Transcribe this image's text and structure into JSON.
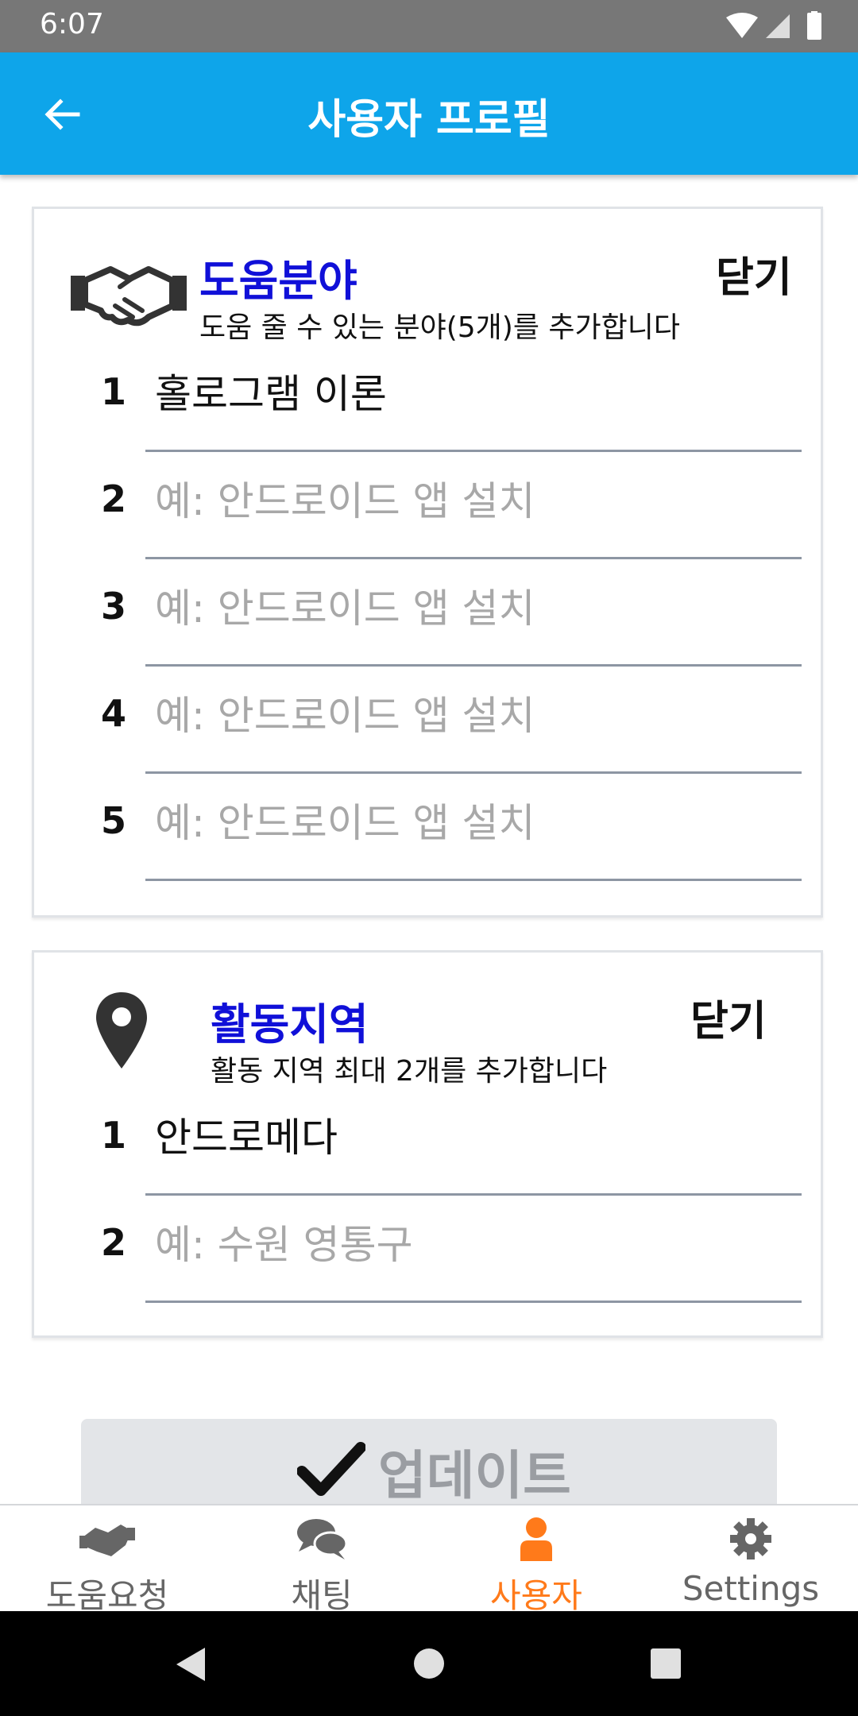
{
  "status_bar": {
    "time": "6:07"
  },
  "app_bar": {
    "title": "사용자 프로필"
  },
  "help_areas": {
    "title": "도움분야",
    "subtitle": "도움 줄 수 있는 분야(5개)를 추가합니다",
    "close_label": "닫기",
    "items": [
      {
        "number": "1",
        "value": "홀로그램 이론",
        "placeholder": ""
      },
      {
        "number": "2",
        "value": "",
        "placeholder": "예: 안드로이드 앱 설치"
      },
      {
        "number": "3",
        "value": "",
        "placeholder": "예: 안드로이드 앱 설치"
      },
      {
        "number": "4",
        "value": "",
        "placeholder": "예: 안드로이드 앱 설치"
      },
      {
        "number": "5",
        "value": "",
        "placeholder": "예: 안드로이드 앱 설치"
      }
    ]
  },
  "activity_region": {
    "title": "활동지역",
    "subtitle": "활동 지역 최대 2개를 추가합니다",
    "close_label": "닫기",
    "items": [
      {
        "number": "1",
        "value": "안드로메다",
        "placeholder": ""
      },
      {
        "number": "2",
        "value": "",
        "placeholder": "예: 수원 영통구"
      }
    ]
  },
  "update_button": {
    "label": "업데이트"
  },
  "bottom_nav": {
    "items": [
      {
        "label": "도움요청",
        "icon": "handshake-icon",
        "active": false
      },
      {
        "label": "채팅",
        "icon": "chat-icon",
        "active": false
      },
      {
        "label": "사용자",
        "icon": "user-icon",
        "active": true
      },
      {
        "label": "Settings",
        "icon": "gear-icon",
        "active": false
      }
    ]
  },
  "colors": {
    "app_bar": "#0ea5ea",
    "card_title": "#1010d8",
    "active_nav": "#ff7a1a",
    "inactive_nav": "#666666"
  }
}
